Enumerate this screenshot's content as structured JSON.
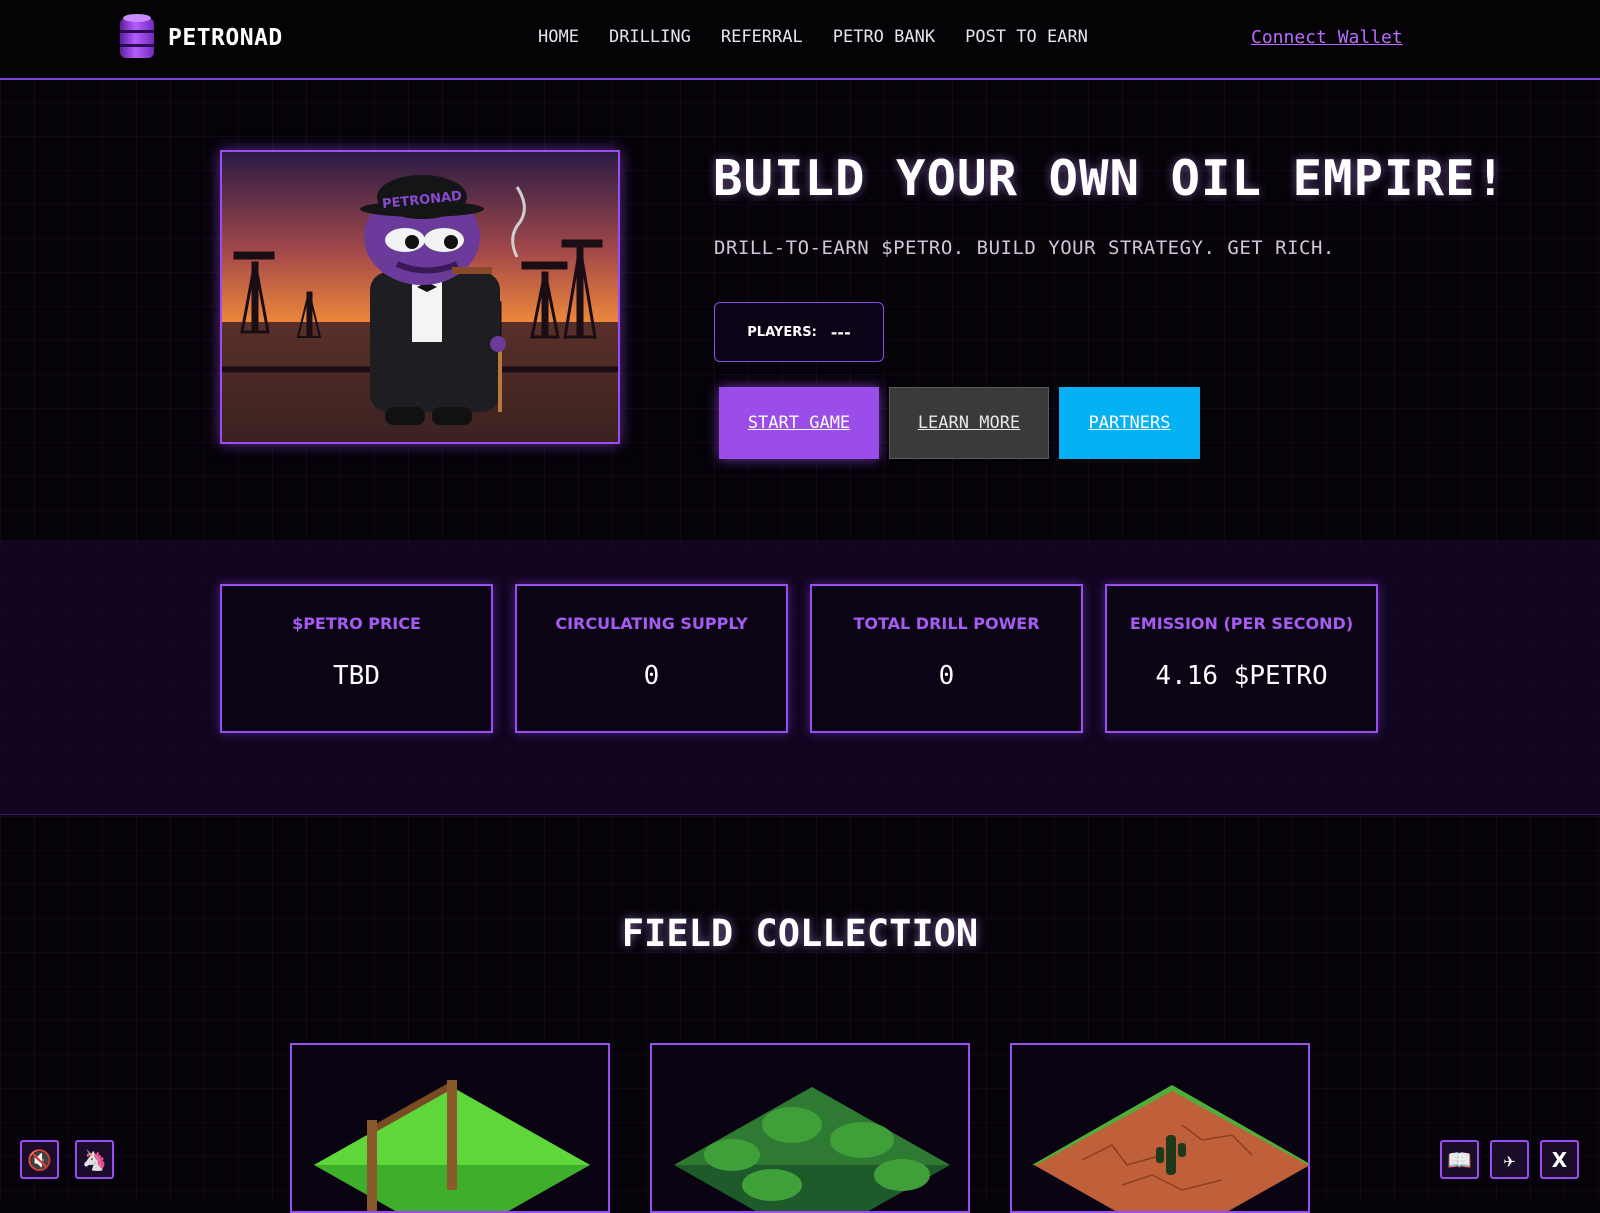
{
  "nav": {
    "brand": "PETRONAD",
    "links": [
      "HOME",
      "DRILLING",
      "REFERRAL",
      "PETRO BANK",
      "POST TO EARN"
    ],
    "connect_wallet": "Connect Wallet"
  },
  "hero": {
    "image_caption_text": "PETRONAD",
    "headline": "BUILD YOUR OWN OIL EMPIRE!",
    "subheadline": "DRILL-TO-EARN $PETRO. BUILD YOUR STRATEGY. GET RICH.",
    "players_label": "PLAYERS:",
    "players_value": "---",
    "buttons": {
      "start": "START GAME",
      "learn": "LEARN MORE",
      "partners": "PARTNERS"
    }
  },
  "stats": [
    {
      "title": "$PETRO PRICE",
      "value": "TBD"
    },
    {
      "title": "CIRCULATING SUPPLY",
      "value": "0"
    },
    {
      "title": "TOTAL DRILL POWER",
      "value": "0"
    },
    {
      "title": "EMISSION (PER SECOND)",
      "value": "4.16 $PETRO"
    }
  ],
  "field_collection": {
    "title": "FIELD COLLECTION",
    "cards": [
      {
        "icon": "grassland-field-icon"
      },
      {
        "icon": "jungle-field-icon"
      },
      {
        "icon": "desert-field-icon"
      }
    ]
  },
  "corner_buttons": {
    "left": [
      {
        "icon": "mute-speaker-icon",
        "glyph": "🔇"
      },
      {
        "icon": "unicorn-icon",
        "glyph": "🦄"
      }
    ],
    "right": [
      {
        "icon": "book-icon",
        "glyph": "📖"
      },
      {
        "icon": "telegram-icon",
        "glyph": "✈"
      },
      {
        "icon": "x-icon",
        "glyph": "X"
      }
    ]
  },
  "colors": {
    "accent": "#9a4df2",
    "start_button": "#9a4de8",
    "learn_button": "#3a3a3a",
    "partners_button": "#05b0f3",
    "background": "#050208"
  }
}
